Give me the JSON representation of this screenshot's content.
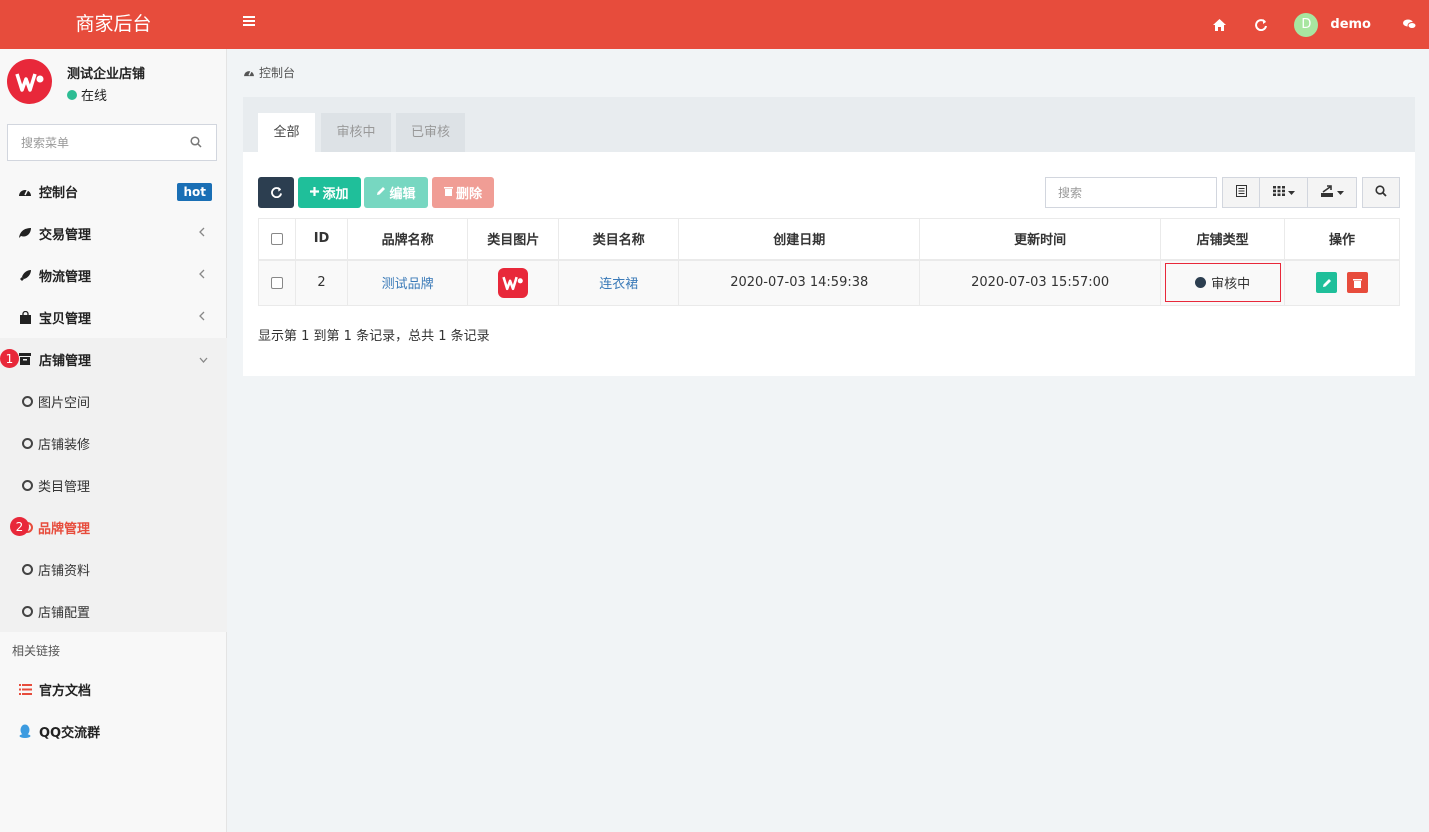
{
  "header": {
    "brand": "商家后台",
    "user_initial": "D",
    "user_name": "demo"
  },
  "sidebar": {
    "shop_name": "测试企业店铺",
    "shop_status": "在线",
    "search_placeholder": "搜索菜单",
    "menu": [
      {
        "label": "控制台",
        "badge": "hot"
      },
      {
        "label": "交易管理"
      },
      {
        "label": "物流管理"
      },
      {
        "label": "宝贝管理"
      },
      {
        "label": "店铺管理",
        "step": "1"
      }
    ],
    "submenu": [
      {
        "label": "图片空间"
      },
      {
        "label": "店铺装修"
      },
      {
        "label": "类目管理"
      },
      {
        "label": "品牌管理",
        "step": "2"
      },
      {
        "label": "店铺资料"
      },
      {
        "label": "店铺配置"
      }
    ],
    "links_title": "相关链接",
    "links": [
      {
        "label": "官方文档"
      },
      {
        "label": "QQ交流群"
      }
    ]
  },
  "breadcrumb": "控制台",
  "tabs": [
    "全部",
    "审核中",
    "已审核"
  ],
  "toolbar": {
    "add": "添加",
    "edit": "编辑",
    "delete": "删除",
    "search_placeholder": "搜索"
  },
  "table": {
    "headers": [
      "ID",
      "品牌名称",
      "类目图片",
      "类目名称",
      "创建日期",
      "更新时间",
      "店铺类型",
      "操作"
    ],
    "rows": [
      {
        "id": "2",
        "brand": "测试品牌",
        "category": "连衣裙",
        "created": "2020-07-03 14:59:38",
        "updated": "2020-07-03 15:57:00",
        "status": "审核中"
      }
    ]
  },
  "summary": "显示第 1 到第 1 条记录，总共 1 条记录",
  "colors": {
    "primary": "#e74c3c",
    "success": "#1fbf9a",
    "dark": "#2c3e50",
    "link": "#3a7ab8",
    "badge": "#1a6fb5"
  }
}
